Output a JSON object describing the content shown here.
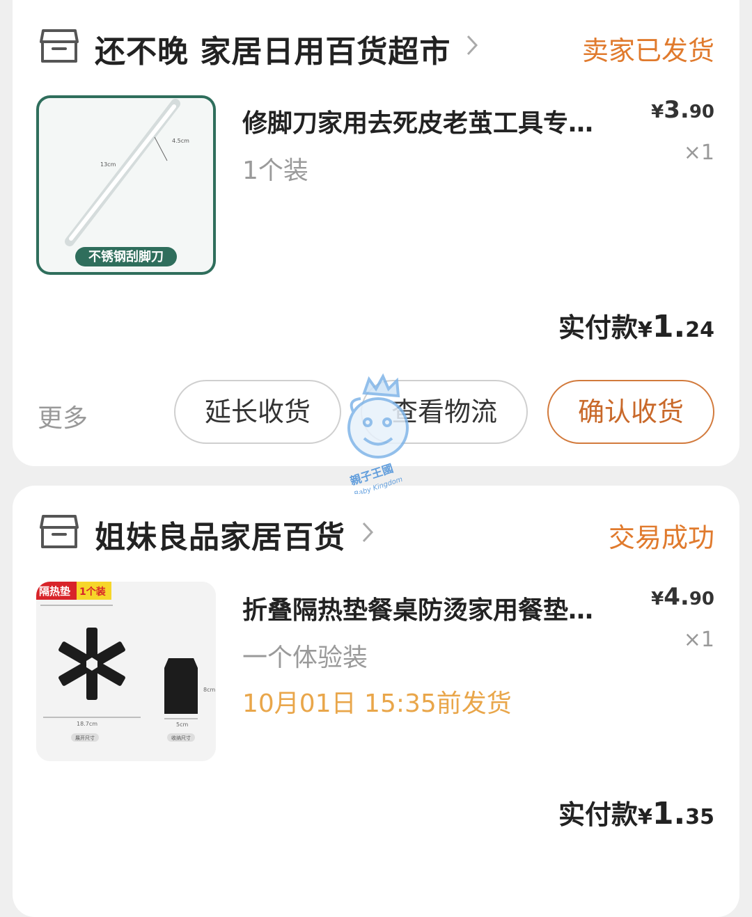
{
  "orders": [
    {
      "store_name": "还不晚 家居日用百货超市",
      "status": "卖家已发货",
      "item": {
        "title": "修脚刀家用去死皮老茧工具专…",
        "spec": "1个装",
        "price_currency": "¥",
        "price_int": "3.",
        "price_dec": "90",
        "quantity": "×1",
        "image_dims": [
          "13cm",
          "4.5cm"
        ],
        "image_label": "不锈钢刮脚刀"
      },
      "paid_label": "实付款",
      "paid_currency": "¥",
      "paid_int": "1.",
      "paid_dec": "24",
      "more_label": "更多",
      "buttons": [
        "延长收货",
        "查看物流",
        "确认收货"
      ]
    },
    {
      "store_name": "姐妹良品家居百货",
      "status": "交易成功",
      "item": {
        "title": "折叠隔热垫餐桌防烫家用餐垫…",
        "spec": "一个体验装",
        "ship_note": "10月01日 15:35前发货",
        "price_currency": "¥",
        "price_int": "4.",
        "price_dec": "90",
        "quantity": "×1",
        "image_tag_a": "隔热垫",
        "image_tag_b": "1个装",
        "image_dims": [
          "18.7cm",
          "5cm",
          "8cm"
        ],
        "image_captions": [
          "展开尺寸",
          "收纳尺寸"
        ]
      },
      "paid_label": "实付款",
      "paid_currency": "¥",
      "paid_int": "1.",
      "paid_dec": "35"
    }
  ],
  "watermark": {
    "cn": "親子王國",
    "en": "Baby Kingdom"
  },
  "colors": {
    "accent_orange": "#e07a2d",
    "ship_yellow": "#e9a64a",
    "background": "#efefef"
  },
  "icons": [
    "store-icon",
    "chevron-right-icon"
  ]
}
